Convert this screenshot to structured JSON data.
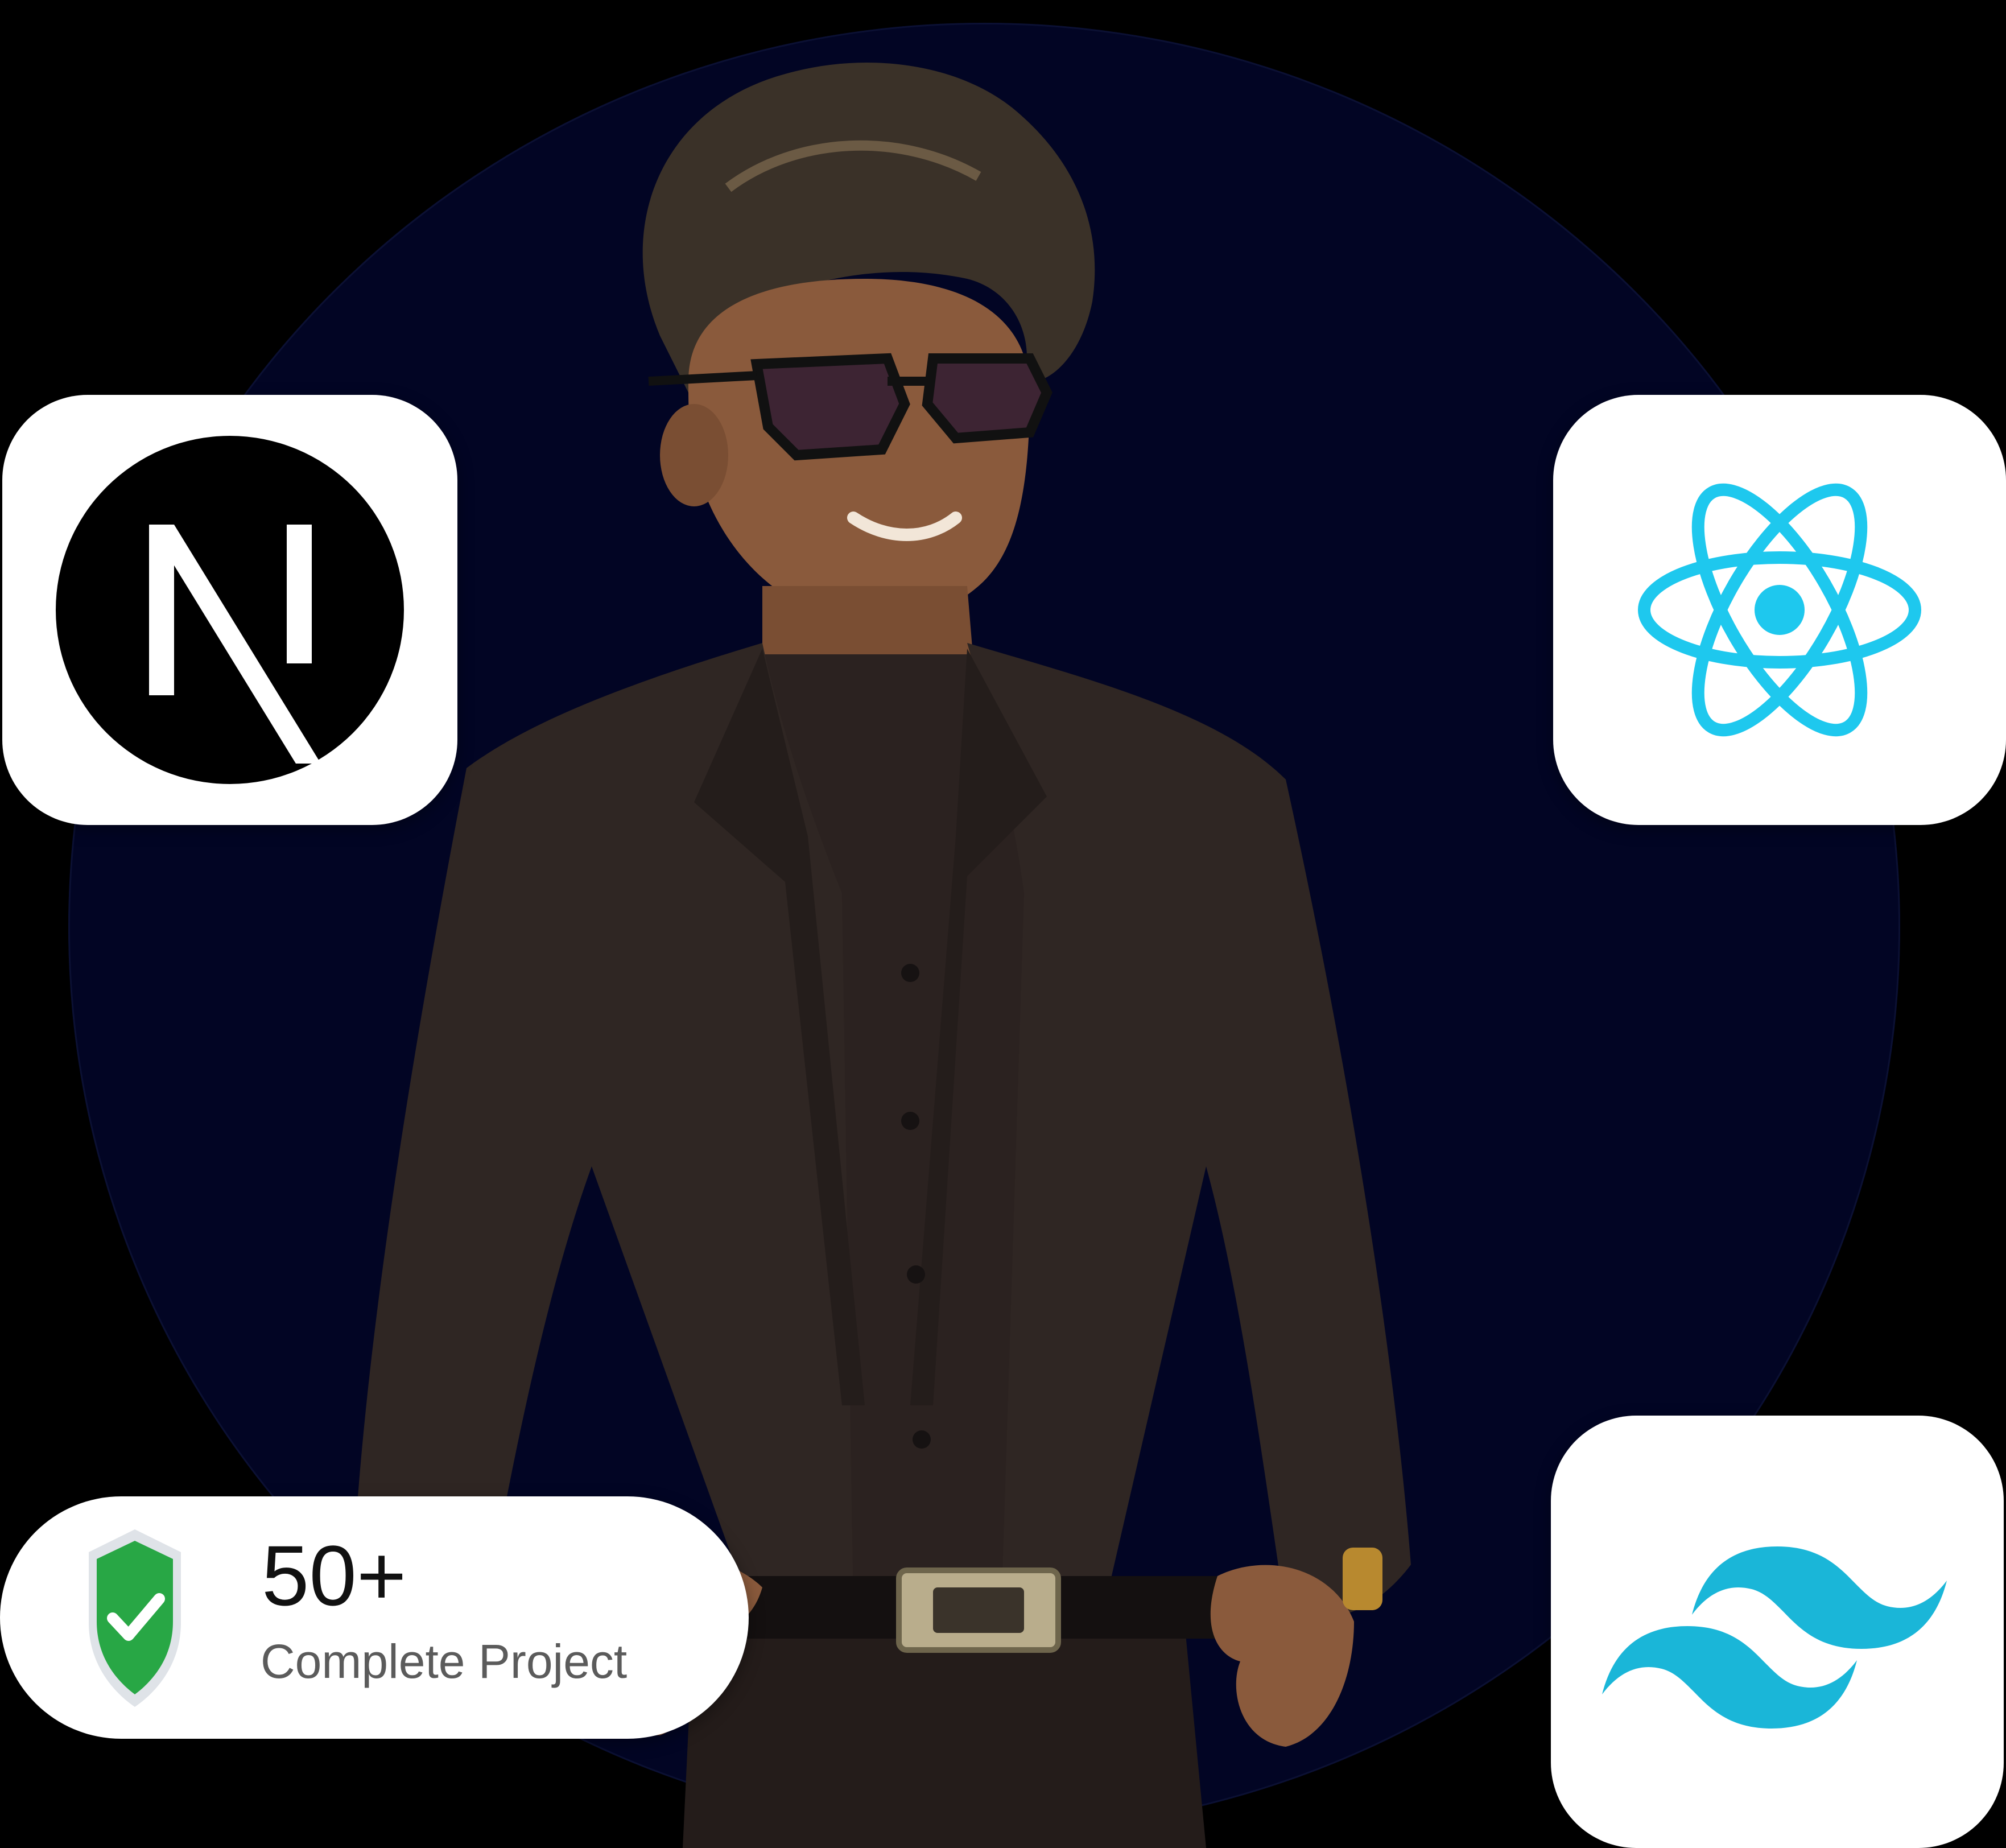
{
  "background_color": "#000000",
  "circle_color": "#020524",
  "tech_icons": [
    {
      "name": "nextjs-logo",
      "glyph": "N"
    },
    {
      "name": "react-logo",
      "color": "#1ec8ee"
    },
    {
      "name": "tailwind-logo",
      "color": "#1ab6d8"
    }
  ],
  "stat": {
    "value": "50+",
    "label": "Complete Project",
    "icon": "shield-check-icon",
    "icon_color": "#28a745"
  }
}
